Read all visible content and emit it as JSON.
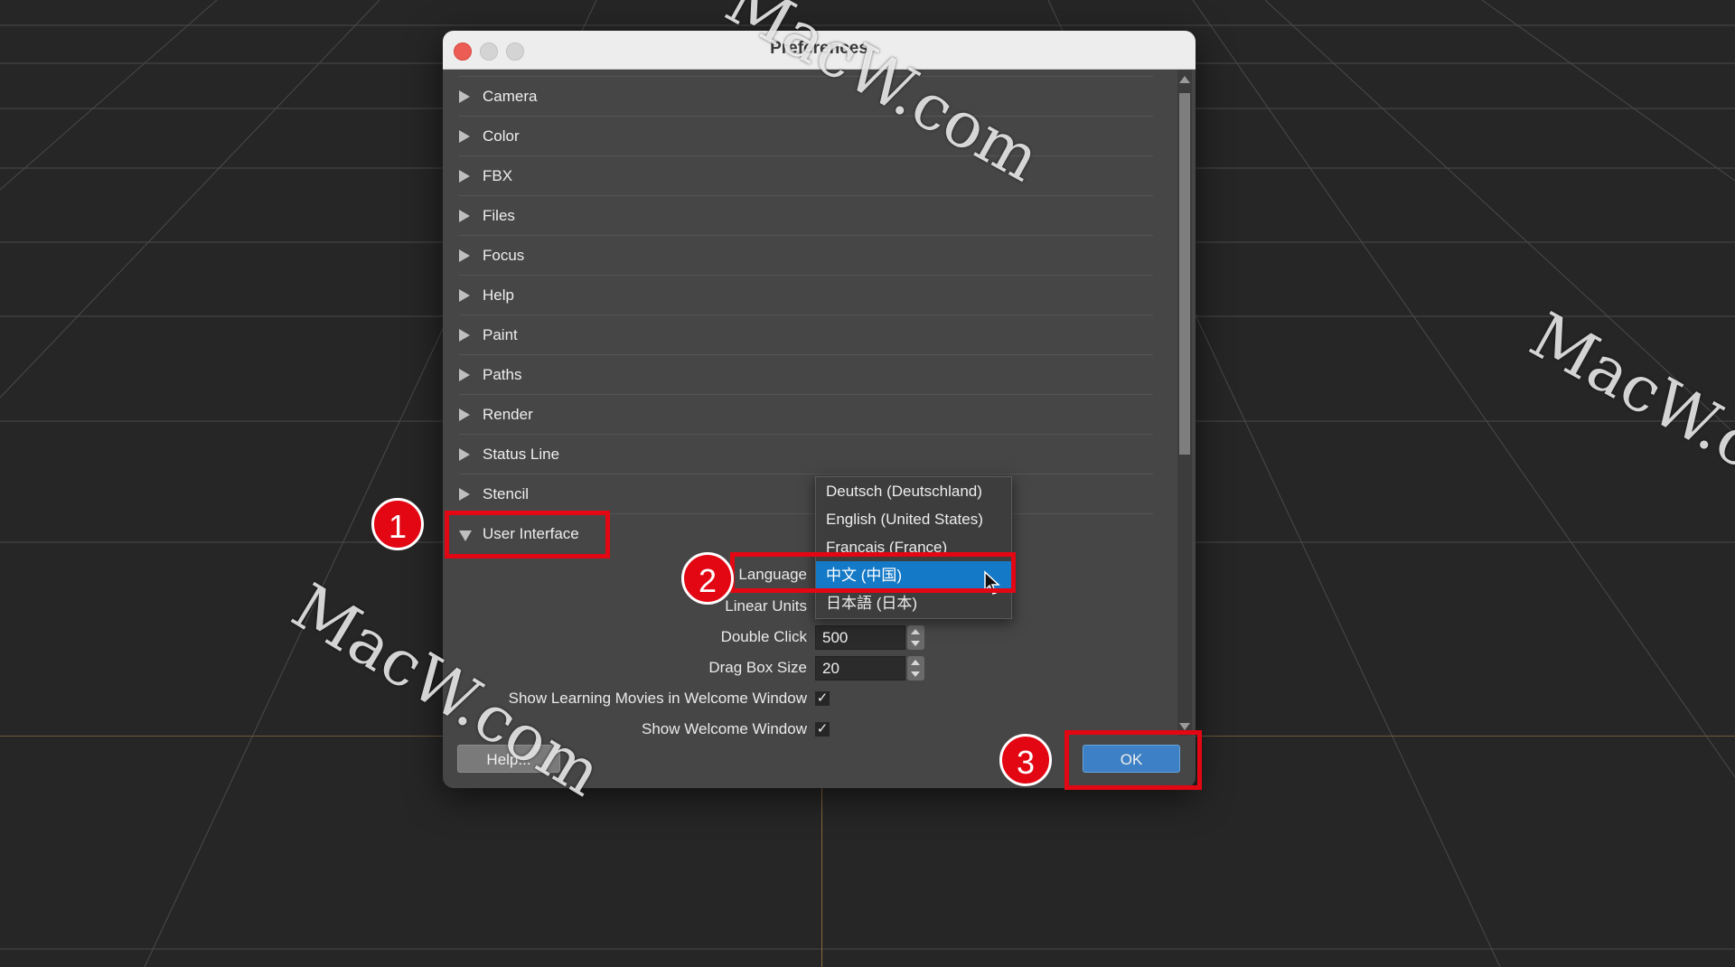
{
  "watermark": "MacW.com",
  "dialog": {
    "title": "Preferences",
    "categories": [
      {
        "label": "Camera",
        "expanded": false
      },
      {
        "label": "Color",
        "expanded": false
      },
      {
        "label": "FBX",
        "expanded": false
      },
      {
        "label": "Files",
        "expanded": false
      },
      {
        "label": "Focus",
        "expanded": false
      },
      {
        "label": "Help",
        "expanded": false
      },
      {
        "label": "Paint",
        "expanded": false
      },
      {
        "label": "Paths",
        "expanded": false
      },
      {
        "label": "Render",
        "expanded": false
      },
      {
        "label": "Status Line",
        "expanded": false
      },
      {
        "label": "Stencil",
        "expanded": false
      },
      {
        "label": "User Interface",
        "expanded": true
      }
    ],
    "user_interface": {
      "language_label": "Language",
      "linear_units_label": "Linear Units",
      "double_click_label": "Double Click",
      "double_click_value": "500",
      "drag_box_label": "Drag Box Size",
      "drag_box_value": "20",
      "show_learning_label": "Show Learning Movies in Welcome Window",
      "show_learning_checked": true,
      "show_welcome_label": "Show Welcome Window",
      "show_welcome_checked": true
    },
    "language_options": [
      "Deutsch (Deutschland)",
      "English (United States)",
      "Francais (France)",
      "中文 (中国)",
      "日本語 (日本)"
    ],
    "language_selected": "中文 (中国)",
    "help_button": "Help...",
    "ok_button": "OK"
  },
  "annotations": {
    "step1": "1",
    "step2": "2",
    "step3": "3",
    "color": "#e30613"
  }
}
